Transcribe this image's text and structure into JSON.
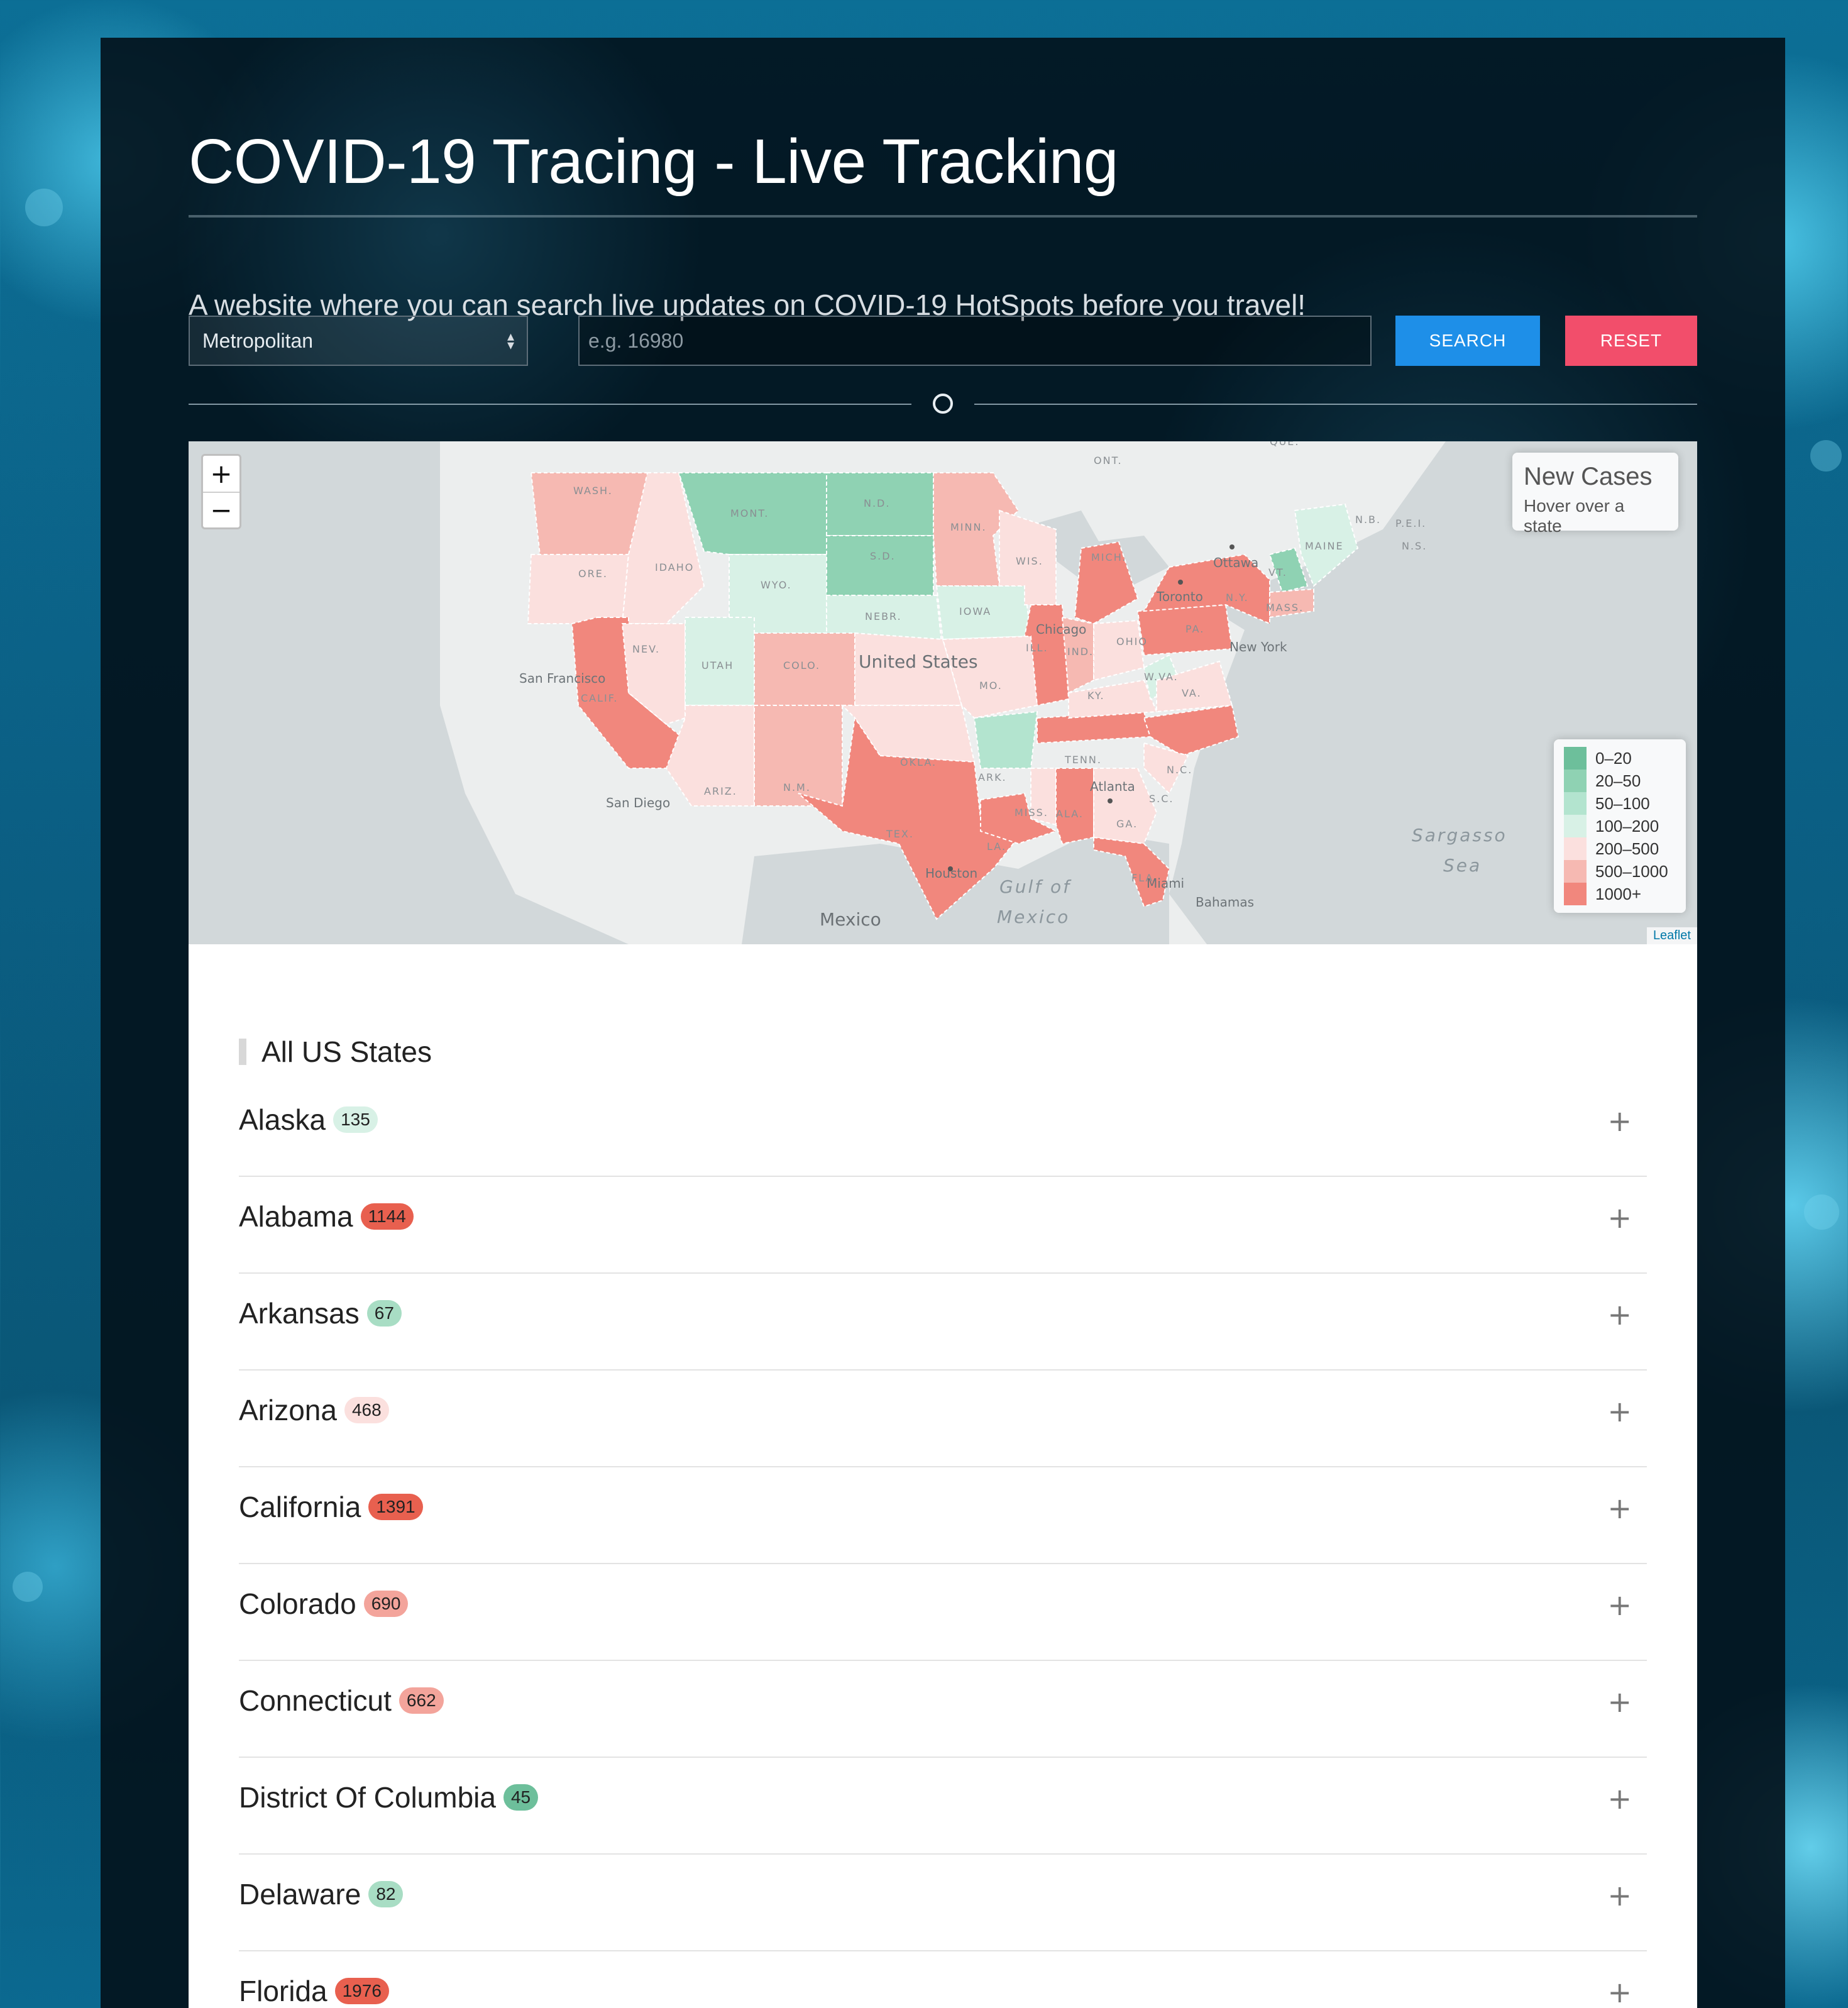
{
  "header": {
    "title": "COVID-19 Tracing - Live Tracking",
    "subtitle": "A website where you can search live updates on COVID-19 HotSpots before you travel!"
  },
  "search": {
    "select_value": "Metropolitan",
    "placeholder": "e.g. 16980",
    "search_label": "SEARCH",
    "reset_label": "RESET"
  },
  "map": {
    "zoom_in": "+",
    "zoom_out": "−",
    "info_title": "New Cases",
    "info_subtitle": "Hover over a state",
    "attribution": "Leaflet",
    "legend": [
      {
        "label": "0–20",
        "color": "#6dbf9b"
      },
      {
        "label": "20–50",
        "color": "#8fd2b3"
      },
      {
        "label": "50–100",
        "color": "#b3e4cf"
      },
      {
        "label": "100–200",
        "color": "#d8f1e6"
      },
      {
        "label": "200–500",
        "color": "#fbe0de"
      },
      {
        "label": "500–1000",
        "color": "#f6b9b2"
      },
      {
        "label": "1000+",
        "color": "#f1877d"
      }
    ],
    "place_labels": {
      "ont": "ONT.",
      "que": "QUE.",
      "wash": "WASH.",
      "mont": "MONT.",
      "nd": "N.D.",
      "minn": "MINN.",
      "sd": "S.D.",
      "ore": "ORE.",
      "idaho": "IDAHO",
      "wyo": "WYO.",
      "wis": "WIS.",
      "mich": "MICH.",
      "maine": "MAINE",
      "nb": "N.B.",
      "pei": "P.E.I.",
      "ns": "N.S.",
      "ottawa": "Ottawa",
      "toronto": "Toronto",
      "ny": "N.Y.",
      "vt": "VT.",
      "mass": "MASS.",
      "nebr": "NEBR.",
      "iowa": "IOWA",
      "chicago": "Chicago",
      "ill": "ILL.",
      "ind": "IND.",
      "ohio": "OHIO",
      "pa": "PA.",
      "new_york": "New York",
      "nev": "NEV.",
      "utah": "UTAH",
      "colo": "COLO.",
      "united_states": "United States",
      "san_francisco": "San Francisco",
      "calif": "CALIF.",
      "mo": "MO.",
      "ky": "KY.",
      "wva": "W.VA.",
      "va": "VA.",
      "okla": "OKLA.",
      "ark": "ARK.",
      "tenn": "TENN.",
      "nc": "N.C.",
      "san_diego": "San Diego",
      "ariz": "ARIZ.",
      "nm": "N.M.",
      "atlanta": "Atlanta",
      "sc": "S.C.",
      "miss": "MISS.",
      "ala": "ALA.",
      "ga": "GA.",
      "tex": "TEX.",
      "la": "LA.",
      "houston": "Houston",
      "fla": "FLA.",
      "miami": "Miami",
      "bahamas": "Bahamas",
      "gulf1": "Gulf of",
      "gulf2": "Mexico",
      "sargasso1": "Sargasso",
      "sargasso2": "Sea",
      "mexico": "Mexico"
    }
  },
  "list": {
    "header": "All US States",
    "states": [
      {
        "name": "Alaska",
        "count": "135",
        "color": "#d8f1e6"
      },
      {
        "name": "Alabama",
        "count": "1144",
        "color": "#e8604f"
      },
      {
        "name": "Arkansas",
        "count": "67",
        "color": "#a8ddc4"
      },
      {
        "name": "Arizona",
        "count": "468",
        "color": "#fbe0de"
      },
      {
        "name": "California",
        "count": "1391",
        "color": "#e8604f"
      },
      {
        "name": "Colorado",
        "count": "690",
        "color": "#f3a49b"
      },
      {
        "name": "Connecticut",
        "count": "662",
        "color": "#f3a49b"
      },
      {
        "name": "District Of Columbia",
        "count": "45",
        "color": "#6dbf9b"
      },
      {
        "name": "Delaware",
        "count": "82",
        "color": "#a8ddc4"
      },
      {
        "name": "Florida",
        "count": "1976",
        "color": "#e8604f"
      }
    ],
    "expand_icon": "+"
  }
}
